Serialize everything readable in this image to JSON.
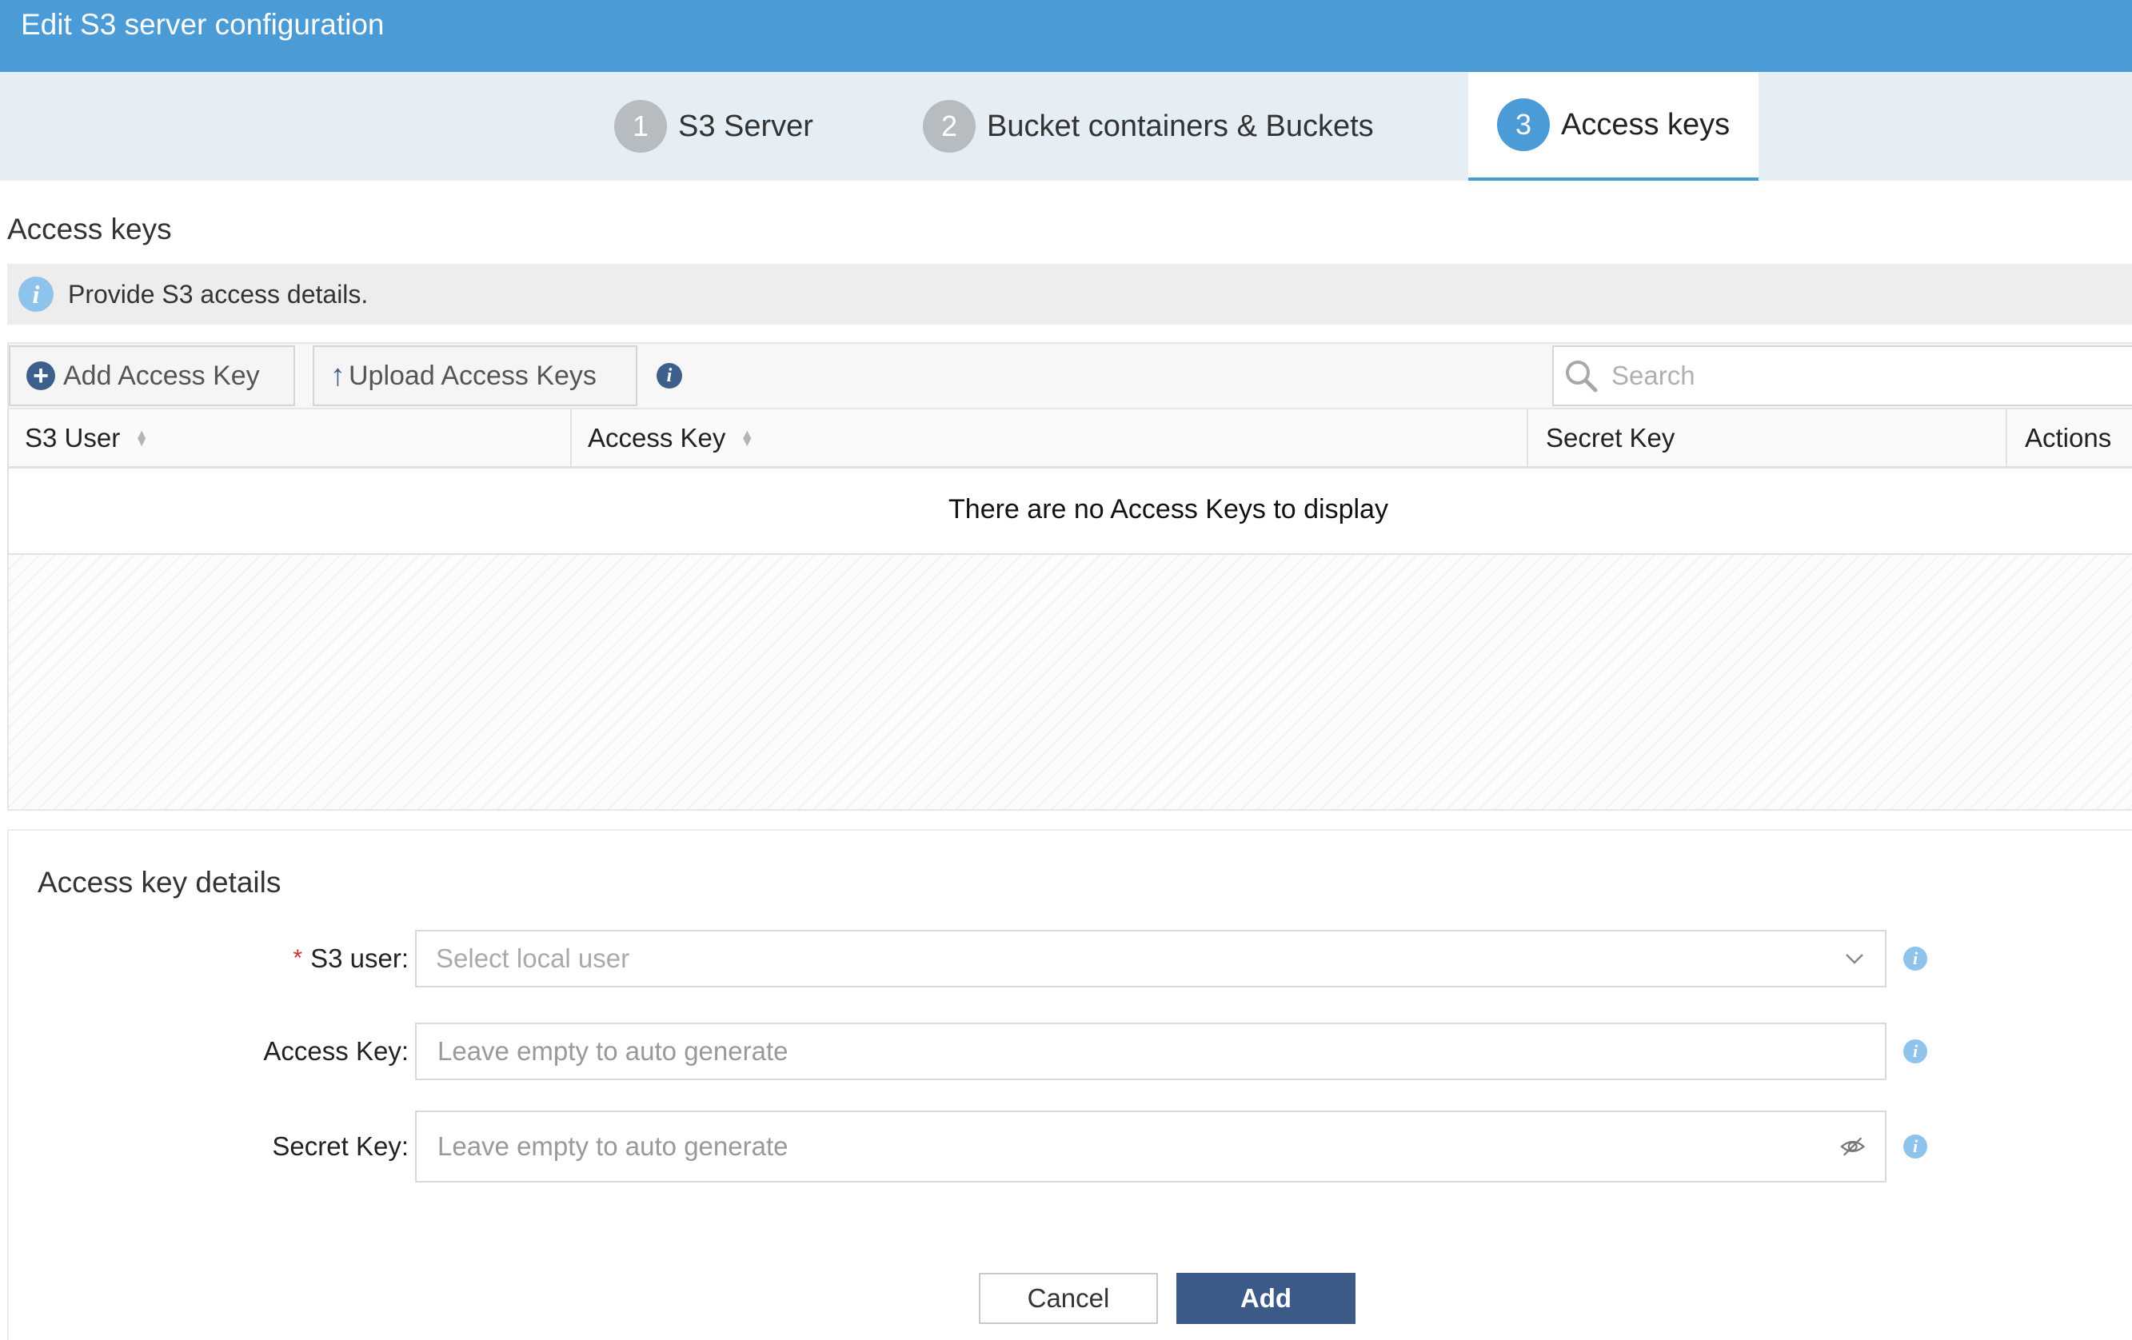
{
  "window": {
    "title": "Edit S3 server configuration"
  },
  "steps": [
    {
      "number": "1",
      "label": "S3 Server",
      "active": false
    },
    {
      "number": "2",
      "label": "Bucket containers & Buckets",
      "active": false
    },
    {
      "number": "3",
      "label": "Access keys",
      "active": true
    }
  ],
  "section": {
    "title": "Access keys",
    "info": "Provide S3 access details."
  },
  "toolbar": {
    "add_label": "Add Access Key",
    "upload_label": "Upload Access Keys",
    "search_placeholder": "Search"
  },
  "grid": {
    "columns": [
      "S3 User",
      "Access Key",
      "Secret Key",
      "Actions"
    ],
    "empty_message": "There are no Access Keys to display"
  },
  "details": {
    "title": "Access key details",
    "fields": {
      "s3_user": {
        "label": "S3 user",
        "placeholder": "Select local user",
        "required": true
      },
      "access_key": {
        "label": "Access Key",
        "placeholder": "Leave empty to auto generate"
      },
      "secret_key": {
        "label": "Secret Key",
        "placeholder": "Leave empty to auto generate"
      }
    }
  },
  "buttons": {
    "cancel": "Cancel",
    "add": "Add"
  },
  "colors": {
    "primary": "#4a9bd6",
    "dark_primary": "#3c5a87",
    "required": "#d32f2f",
    "info_icon": "#8ec4ec"
  },
  "icons": [
    "info-icon",
    "plus-circle-icon",
    "arrow-up-icon",
    "search-icon",
    "sort-icon",
    "chevron-down-icon",
    "eye-slash-icon"
  ]
}
